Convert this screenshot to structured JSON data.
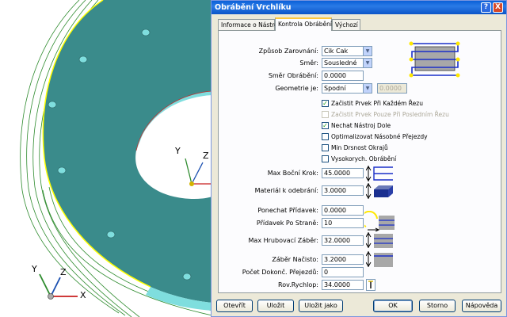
{
  "viewport": {
    "axis_labels": [
      "Y",
      "Z",
      "X"
    ],
    "colors": {
      "disc": "#3a8b8b",
      "disc_edge": "#ffff00",
      "hole": "#7fdede",
      "toolpath": "#2e8b2e"
    }
  },
  "dialog": {
    "title": "Obrábění Vrchlíku",
    "help_glyph": "?",
    "close_glyph": "X",
    "tabs": [
      "Informace o Nástroji",
      "Kontrola Obrábění",
      "Výchozí"
    ],
    "active_tab": 1,
    "fields": {
      "zpusob_zarovnani": {
        "label": "Způsob Zarovnání:",
        "value": "Cik Cak"
      },
      "smer": {
        "label": "Směr:",
        "value": "Sousledné"
      },
      "smer_obrabeni": {
        "label": "Směr Obrábění:",
        "value": "0.0000"
      },
      "geometrie": {
        "label": "Geometrie je:",
        "value": "Spodní",
        "extra": "0.0000"
      },
      "max_bocni_krok": {
        "label": "Max Boční Krok:",
        "value": "45.0000"
      },
      "material": {
        "label": "Materiál k odebrání:",
        "value": "3.0000"
      },
      "ponechat_pridavek": {
        "label": "Ponechat Přídavek:",
        "value": "0.0000"
      },
      "pridavek_po_strane": {
        "label": "Přídavek Po Straně:",
        "value": "10"
      },
      "max_hrubovaci": {
        "label": "Max Hrubovací Záběr:",
        "value": "32.0000"
      },
      "zaber_nacisto": {
        "label": "Záběr Načisto:",
        "value": "3.2000"
      },
      "pocet_dokonc": {
        "label": "Počet Dokonč. Přejezdů:",
        "value": "0"
      },
      "rov_rychlop": {
        "label": "Rov.Rychlop:",
        "value": "34.0000"
      }
    },
    "checkboxes": [
      {
        "label": "Začistit Prvek Při Každém Řezu",
        "checked": true,
        "enabled": true
      },
      {
        "label": "Začistit Prvek Pouze Při Posledním Řezu",
        "checked": false,
        "enabled": false
      },
      {
        "label": "Nechat Nástroj Dole",
        "checked": true,
        "enabled": true
      },
      {
        "label": "Optimalizovat Násobné Přejezdy",
        "checked": false,
        "enabled": true
      },
      {
        "label": "Min Drsnost Okrajů",
        "checked": false,
        "enabled": true
      },
      {
        "label": "Vysokorych. Obrábění",
        "checked": false,
        "enabled": true
      }
    ],
    "check_glyph": "✓",
    "buttons": {
      "otevrit": "Otevřít",
      "ulozit": "Uložit",
      "ulozit_jako": "Uložit jako",
      "ok": "OK",
      "storno": "Storno",
      "napoveda": "Nápověda"
    }
  }
}
